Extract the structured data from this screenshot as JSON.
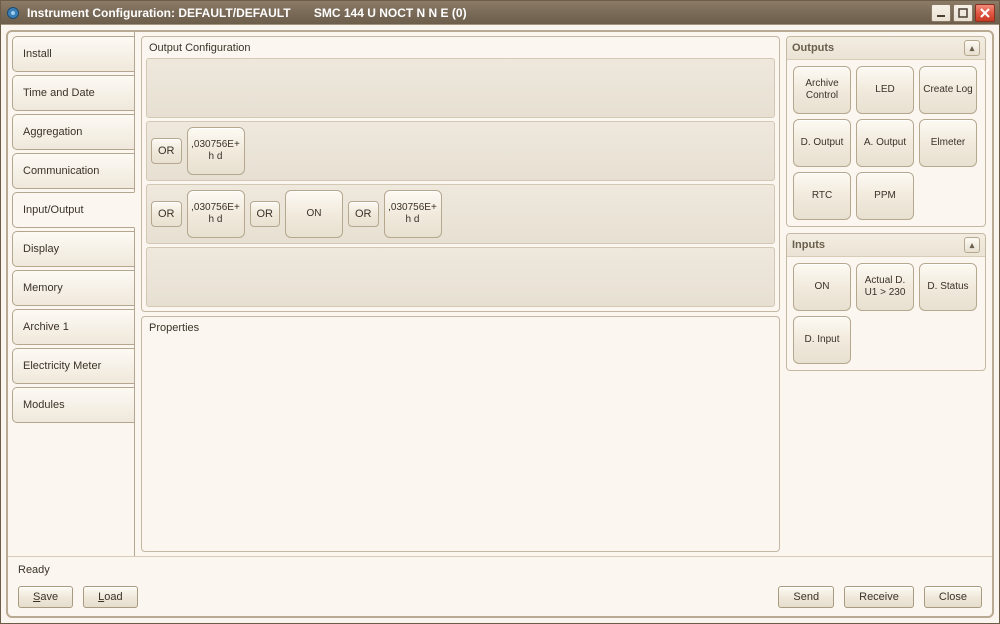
{
  "window": {
    "title": "Instrument Configuration: DEFAULT/DEFAULT       SMC 144 U NOCT N N E (0)"
  },
  "tabs": [
    {
      "label": "Install"
    },
    {
      "label": "Time and Date"
    },
    {
      "label": "Aggregation"
    },
    {
      "label": "Communication"
    },
    {
      "label": "Input/Output"
    },
    {
      "label": "Display"
    },
    {
      "label": "Memory"
    },
    {
      "label": "Archive 1"
    },
    {
      "label": "Electricity Meter"
    },
    {
      "label": "Modules"
    }
  ],
  "active_tab_index": 4,
  "output_config": {
    "title": "Output Configuration",
    "slots": [
      {
        "items": []
      },
      {
        "items": [
          {
            "kind": "logic",
            "label": "OR"
          },
          {
            "kind": "block",
            "label": ",030756E+ h d"
          }
        ]
      },
      {
        "items": [
          {
            "kind": "logic",
            "label": "OR"
          },
          {
            "kind": "block",
            "label": ",030756E+ h d"
          },
          {
            "kind": "logic",
            "label": "OR"
          },
          {
            "kind": "block",
            "label": "ON"
          },
          {
            "kind": "logic",
            "label": "OR"
          },
          {
            "kind": "block",
            "label": ",030756E+ h d"
          }
        ]
      },
      {
        "items": []
      }
    ]
  },
  "properties": {
    "title": "Properties"
  },
  "outputs_panel": {
    "title": "Outputs",
    "items": [
      {
        "label": "Archive Control"
      },
      {
        "label": "LED"
      },
      {
        "label": "Create Log"
      },
      {
        "label": "D. Output"
      },
      {
        "label": "A. Output"
      },
      {
        "label": "Elmeter"
      },
      {
        "label": "RTC"
      },
      {
        "label": "PPM"
      }
    ]
  },
  "inputs_panel": {
    "title": "Inputs",
    "items": [
      {
        "label": "ON"
      },
      {
        "label": "Actual D. U1 > 230"
      },
      {
        "label": "D. Status"
      },
      {
        "label": "D. Input"
      }
    ]
  },
  "footer": {
    "status": "Ready",
    "save": "Save",
    "load": "Load",
    "send": "Send",
    "receive": "Receive",
    "close": "Close"
  }
}
